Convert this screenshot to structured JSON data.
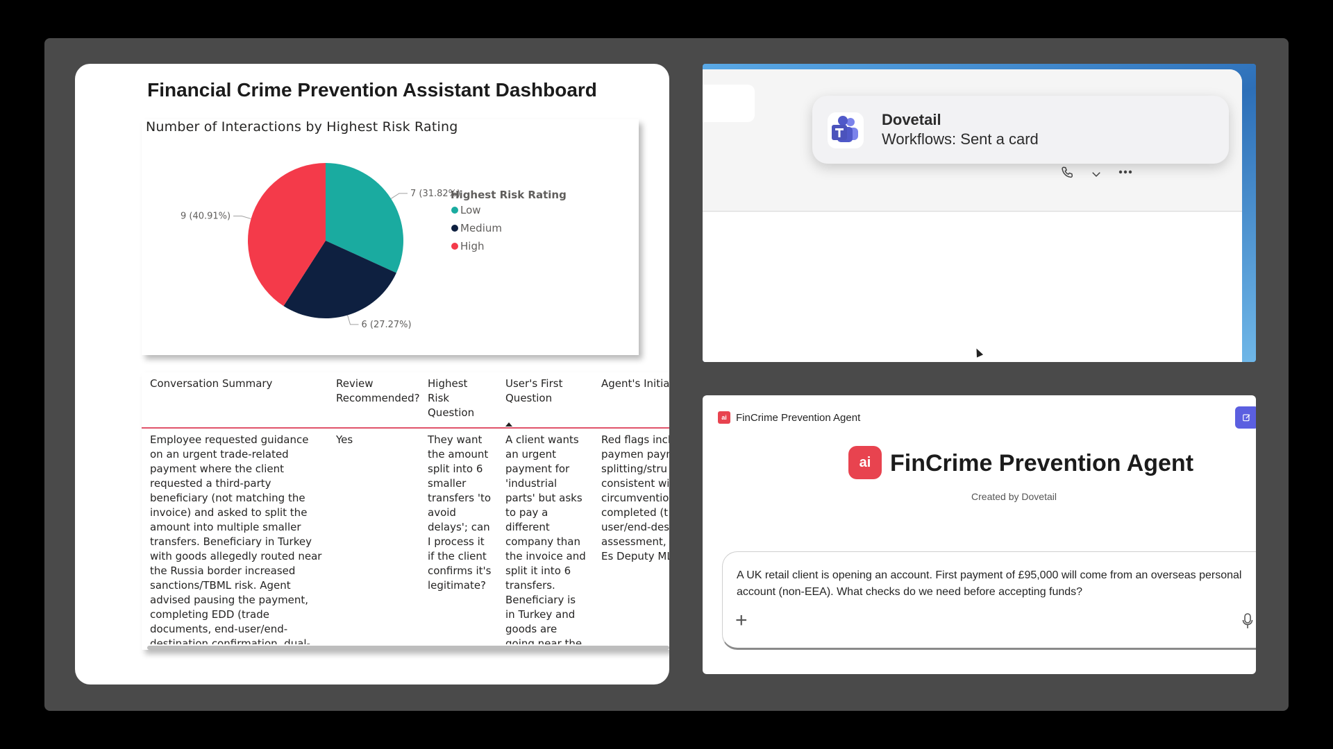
{
  "dashboard": {
    "title": "Financial Crime Prevention Assistant Dashboard",
    "chart_title": "Number of Interactions by Highest Risk Rating",
    "table": {
      "columns": [
        "Conversation Summary",
        "Review Recommended?",
        "Highest Risk Question",
        "User's First Question",
        "Agent's Initia"
      ],
      "rows": [
        [
          "Employee requested guidance on an urgent trade-related payment where the client requested a third-party beneficiary (not matching the invoice) and asked to split the amount into multiple smaller transfers. Beneficiary in Turkey with goods allegedly routed near the Russia border increased sanctions/TBML risk. Agent advised pausing the payment, completing EDD (trade documents, end-user/end-destination confirmation, dual-use assessment, sanctions screening), and escalating to MLRO for",
          "Yes",
          "They want the amount split into 6 smaller transfers 'to avoid delays'; can I process it if the client confirms it's legitimate?",
          "A client wants an urgent payment for 'industrial parts' but asks to pay a different company than the invoice and split it into 6 transfers. Beneficiary is in Turkey and goods are going near the Russia border. Can I process if the client confirms",
          "Red flags incl party paymen payment splitting/stru and route inc consistent wi potential san circumventio process until completed (t documents, e user/end-des confirmation, assessment, s screening). Es Deputy MLRO"
        ]
      ]
    }
  },
  "chart_data": {
    "type": "pie",
    "title": "Number of Interactions by Highest Risk Rating",
    "legend_title": "Highest Risk Rating",
    "legend_position": "right",
    "slices": [
      {
        "label": "Low",
        "value": 7,
        "percent": 31.82,
        "color": "#1aaba0",
        "data_label": "7 (31.82%)"
      },
      {
        "label": "Medium",
        "value": 6,
        "percent": 27.27,
        "color": "#0e2040",
        "data_label": "6 (27.27%)"
      },
      {
        "label": "High",
        "value": 9,
        "percent": 40.91,
        "color": "#f43a4a",
        "data_label": "9 (40.91%)"
      }
    ]
  },
  "teams": {
    "toast_app": "Dovetail",
    "toast_message": "Workflows: Sent a card",
    "icons": [
      "teams-icon",
      "call-icon",
      "chevron-down-icon",
      "more-icon"
    ]
  },
  "agent": {
    "header_title": "FinCrime Prevention Agent",
    "title": "FinCrime Prevention Agent",
    "logo_text": "ai",
    "created_by": "Created by Dovetail",
    "prompt": "A UK retail client is opening an account. First payment of £95,000 will come from an overseas personal account (non-EEA). What checks do we need before accepting funds?",
    "accent_color": "#e8434f",
    "icons": [
      "edit-icon",
      "plus-icon",
      "microphone-icon"
    ]
  }
}
